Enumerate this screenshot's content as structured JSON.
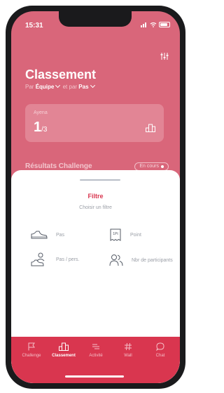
{
  "status_bar": {
    "time": "15:31"
  },
  "header": {
    "title": "Classement",
    "filter_prefix": "Par",
    "filter_group": "Équipe",
    "filter_mid": "et par",
    "filter_metric": "Pas"
  },
  "rank_card": {
    "team": "Ayena",
    "rank": "1",
    "total": "/3"
  },
  "results": {
    "title": "Résultats Challenge",
    "status": "En cours"
  },
  "sheet": {
    "title": "Filtre",
    "subtitle": "Choisir un filtre",
    "options": [
      {
        "label": "Pas",
        "icon": "sneaker-icon"
      },
      {
        "label": "Point",
        "icon": "ticket-icon"
      },
      {
        "label": "Pas / pers.",
        "icon": "person-steps-icon"
      },
      {
        "label": "Nbr de participants",
        "icon": "users-icon"
      }
    ]
  },
  "tabbar": {
    "items": [
      {
        "label": "Challenge",
        "icon": "flag-icon",
        "active": false
      },
      {
        "label": "Classement",
        "icon": "podium-icon",
        "active": true
      },
      {
        "label": "Activité",
        "icon": "activity-icon",
        "active": false
      },
      {
        "label": "Wall",
        "icon": "hash-icon",
        "active": false
      },
      {
        "label": "Chat",
        "icon": "chat-icon",
        "active": false
      }
    ]
  },
  "colors": {
    "brand": "#d9364f",
    "background_dim": "#d9667a"
  }
}
